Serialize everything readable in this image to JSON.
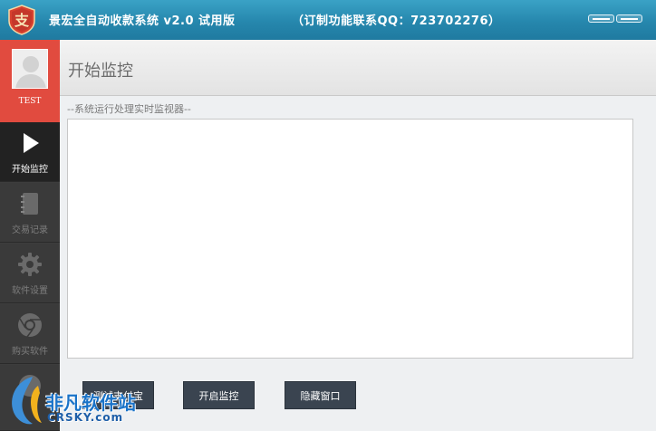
{
  "titlebar": {
    "logo_glyph": "支",
    "app_title": "景宏全自动收款系统 v2.0 试用版",
    "contact": "（订制功能联系QQ：723702276）",
    "logo_color": "#d8412f",
    "bar_color": "#2687ad"
  },
  "sidebar": {
    "username": "TEST",
    "profile_color": "#e14b3f",
    "items": [
      {
        "label": "开始监控",
        "icon": "play-icon",
        "active": true
      },
      {
        "label": "交易记录",
        "icon": "notebook-icon",
        "active": false
      },
      {
        "label": "软件设置",
        "icon": "gear-icon",
        "active": false
      },
      {
        "label": "购买软件",
        "icon": "browser-icon",
        "active": false
      }
    ]
  },
  "main": {
    "title": "开始监控",
    "monitor_caption": "--系统运行处理实时监视器--",
    "monitor_log": ""
  },
  "actions": {
    "btn1_label": "测试支付宝",
    "btn2_label": "开启监控",
    "btn3_label": "隐藏窗口"
  },
  "watermark": {
    "text": "非凡软件站",
    "sub": "CRSKY.com"
  }
}
